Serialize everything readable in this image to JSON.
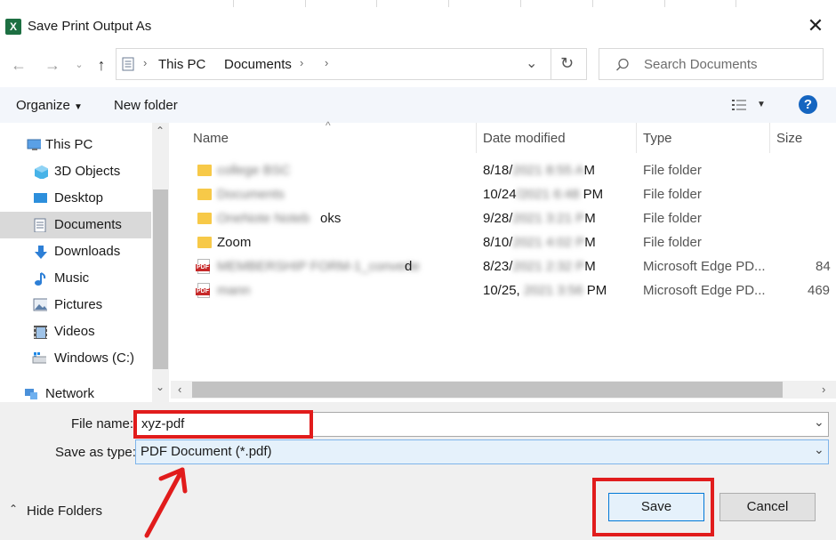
{
  "window": {
    "title": "Save Print Output As",
    "app_icon": "excel-icon"
  },
  "nav": {
    "breadcrumb": [
      "This PC",
      "Documents"
    ],
    "search_placeholder": "Search Documents"
  },
  "toolbar": {
    "organize_label": "Organize",
    "new_folder_label": "New folder",
    "help_label": "?"
  },
  "tree": {
    "items": [
      {
        "label": "This PC",
        "icon": "computer-icon"
      },
      {
        "label": "3D Objects",
        "icon": "cube-icon"
      },
      {
        "label": "Desktop",
        "icon": "desktop-icon"
      },
      {
        "label": "Documents",
        "icon": "document-icon",
        "selected": true
      },
      {
        "label": "Downloads",
        "icon": "download-arrow-icon"
      },
      {
        "label": "Music",
        "icon": "music-note-icon"
      },
      {
        "label": "Pictures",
        "icon": "picture-icon"
      },
      {
        "label": "Videos",
        "icon": "film-icon"
      },
      {
        "label": "Windows (C:)",
        "icon": "drive-icon"
      },
      {
        "label": "Network",
        "icon": "network-icon"
      }
    ]
  },
  "files": {
    "columns": [
      "Name",
      "Date modified",
      "Type",
      "Size"
    ],
    "rows": [
      {
        "name": "college BSC",
        "name_visible": "",
        "date": "8/18/2021 8:55 AM",
        "date_visible_start": "8/18/",
        "date_visible_end": "M",
        "type": "File folder",
        "size": "",
        "icon": "folder-icon"
      },
      {
        "name": "Documents",
        "name_visible": "",
        "date": "10/24/2021 6:48 PM",
        "date_visible_start": "10/24",
        "date_visible_end": "PM",
        "type": "File folder",
        "size": "",
        "icon": "folder-icon"
      },
      {
        "name": "OneNote Notebooks",
        "name_visible": "oks",
        "date": "9/28/2021 3:21 PM",
        "date_visible_start": "9/28/",
        "date_visible_end": "M",
        "type": "File folder",
        "size": "",
        "icon": "folder-icon"
      },
      {
        "name": "Zoom",
        "name_visible": "Zoom",
        "date": "8/10/2021 4:02 PM",
        "date_visible_start": "8/10/",
        "date_visible_end": "M",
        "type": "File folder",
        "size": "",
        "icon": "folder-icon"
      },
      {
        "name": "MEMBERSHIP FORM-1_converted",
        "name_visible": "d",
        "date": "8/23/2021 2:32 PM",
        "date_visible_start": "8/23/",
        "date_visible_end": "M",
        "type": "Microsoft Edge PD...",
        "size": "84",
        "icon": "pdf-icon"
      },
      {
        "name": "mann",
        "name_visible": "",
        "date": "10/25/2021 3:56 PM",
        "date_visible_start": "10/25,",
        "date_visible_end": "PM",
        "type": "Microsoft Edge PD...",
        "size": "469",
        "icon": "pdf-icon"
      }
    ]
  },
  "form": {
    "file_name_label": "File name:",
    "file_name_value": "xyz-pdf",
    "save_type_label": "Save as type:",
    "save_type_value": "PDF Document (*.pdf)"
  },
  "footer": {
    "hide_folders_label": "Hide Folders",
    "save_label": "Save",
    "cancel_label": "Cancel"
  },
  "colors": {
    "highlight_red": "#e11c1c",
    "selected_bg": "#d9d9d9",
    "help_blue": "#1565c0"
  }
}
